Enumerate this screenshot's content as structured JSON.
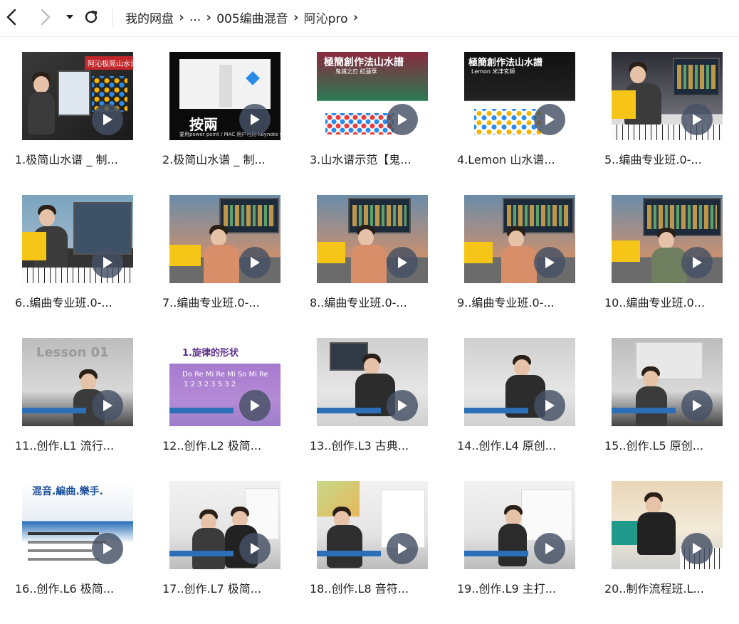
{
  "breadcrumb": {
    "items": [
      "我的网盘",
      "...",
      "005编曲混音",
      "阿沁pro"
    ]
  },
  "nav": {
    "back_icon": "chevron-left-icon",
    "forward_icon": "chevron-right-icon",
    "dropdown_icon": "caret-down-icon",
    "refresh_icon": "refresh-icon"
  },
  "files": [
    {
      "title": "1.极简山水谱 _ 制..."
    },
    {
      "title": "2.极简山水谱 _ 制..."
    },
    {
      "title": "3.山水谱示范【鬼..."
    },
    {
      "title": "4.Lemon 山水谱..."
    },
    {
      "title": "5..编曲专业班.0-..."
    },
    {
      "title": "6..编曲专业班.0-..."
    },
    {
      "title": "7..编曲专业班.0-..."
    },
    {
      "title": "8..编曲专业班.0-..."
    },
    {
      "title": "9..编曲专业班.0-..."
    },
    {
      "title": "10..编曲专业班.0..."
    },
    {
      "title": "11..创作.L1 流行..."
    },
    {
      "title": "12..创作.L2 极简..."
    },
    {
      "title": "13..创作.L3 古典..."
    },
    {
      "title": "14..创作.L4 原创..."
    },
    {
      "title": "15..创作.L5 原创..."
    },
    {
      "title": "16..创作.L6 极简..."
    },
    {
      "title": "17..创作.L7 极简..."
    },
    {
      "title": "18..创作.L8 音符..."
    },
    {
      "title": "19..创作.L9 主打..."
    },
    {
      "title": "20..制作流程班.L..."
    }
  ],
  "thumb_text": {
    "t1": "阿沁极简山水谱",
    "t2a": "按兩",
    "t2b": "要用power point / MAC 用户可用 keynote 编",
    "t3": "極簡創作法山水譜",
    "t3b": "鬼滅之刃 紅蓮華",
    "t4": "極簡創作法山水譜",
    "t4b": "Lemon 米津玄師",
    "t11": "Lesson 01",
    "t12a": "1.旋律的形状",
    "t12b": "Do Re Mi Re Mi So Mi Re",
    "t12c": "1 2 3 2 3 5 3 2",
    "t16": "混音.編曲.樂手."
  },
  "colors": {
    "play_button": "#4a5566",
    "text": "#222222",
    "divider": "#ececec"
  }
}
